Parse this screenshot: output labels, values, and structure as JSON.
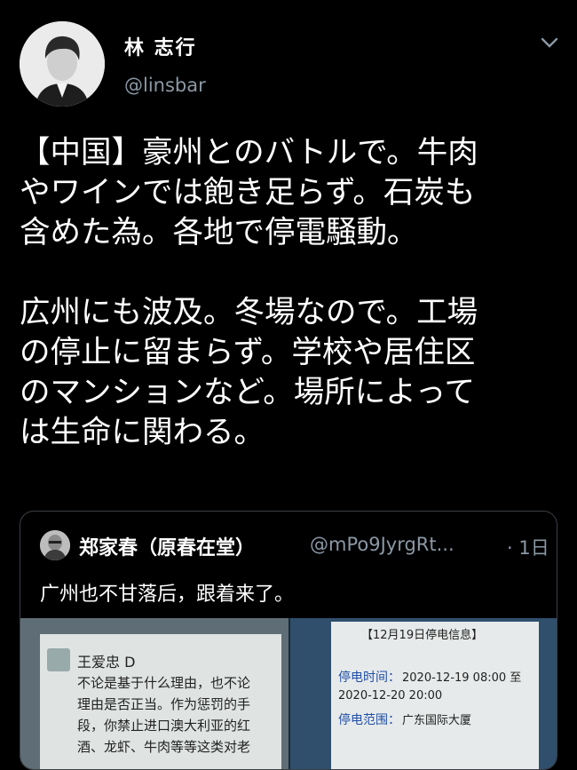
{
  "author": {
    "name": "林 志行",
    "handle": "@linsbar"
  },
  "tweet": {
    "text": "【中国】豪州とのバトルで。牛肉\nやワインでは飽き足らず。石炭も\n含めた為。各地で停電騒動。\n\n広州にも波及。冬場なので。工場\nの停止に留まらず。学校や居住区\nのマンションなど。場所によって\nは生命に関わる。"
  },
  "quote": {
    "name": "郑家春（原春在堂）",
    "handle": "@mPo9JyrgRt...",
    "time": "· 1日",
    "text": "广州也不甘落后，跟着来了。",
    "image_left": {
      "commenter": "王爱忠 D",
      "line1": "不论是基于什么理由，也不论",
      "line2": "理由是否正当。作为惩罚的手",
      "line3": "段，你禁止进口澳大利亚的红",
      "line4": "酒、龙虾、牛肉等等这类对老"
    },
    "image_right": {
      "header": "【12月19日停电信息】",
      "time_label": "停电时间：",
      "time_value": "2020-12-19 08:00 至",
      "time_value2": "2020-12-20 20:00",
      "range_label": "停电范围：",
      "range_value": "广东国际大厦"
    }
  },
  "colors": {
    "background": "#000000",
    "text": "#ffffff",
    "secondary": "#8b98a5",
    "border": "#3a3f44"
  }
}
